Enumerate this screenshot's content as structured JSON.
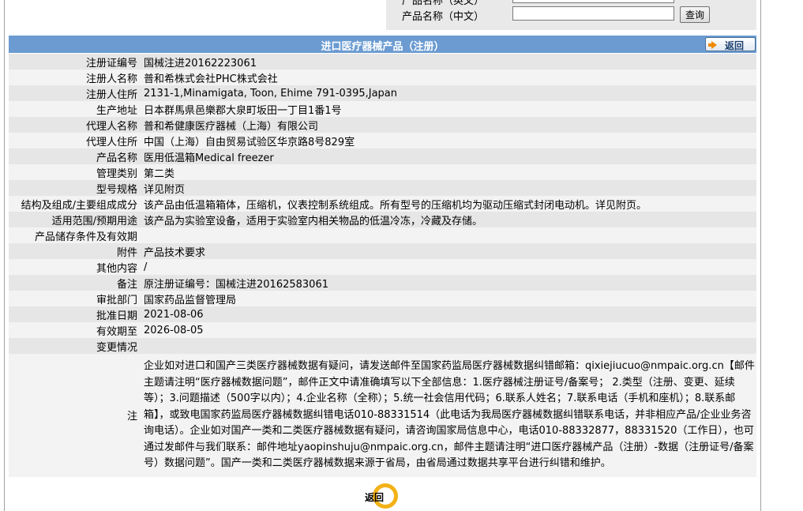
{
  "search": {
    "row1_label": "产品名称（英文）",
    "product_name_cn_label": "产品名称（中文）",
    "product_name_cn_value": "",
    "search_button": "查询"
  },
  "header": {
    "title": "进口医疗器械产品（注册）",
    "back_label": "返回"
  },
  "rows": [
    {
      "label": "注册证编号",
      "value": "国械注进20162223061"
    },
    {
      "label": "注册人名称",
      "value": "普和希株式会社PHC株式会社"
    },
    {
      "label": "注册人住所",
      "value": "2131-1,Minamigata, Toon, Ehime 791-0395,Japan"
    },
    {
      "label": "生产地址",
      "value": "日本群馬県邑樂郡大泉町坂田一丁目1番1号"
    },
    {
      "label": "代理人名称",
      "value": "普和希健康医疗器械（上海）有限公司"
    },
    {
      "label": "代理人住所",
      "value": "中国（上海）自由贸易试验区华京路8号829室"
    },
    {
      "label": "产品名称",
      "value": "医用低温箱Medical freezer"
    },
    {
      "label": "管理类别",
      "value": "第二类"
    },
    {
      "label": "型号规格",
      "value": "详见附页"
    },
    {
      "label": "结构及组成/主要组成成分",
      "value": "该产品由低温箱箱体，压缩机，仪表控制系统组成。所有型号的压缩机均为驱动压缩式封闭电动机。详见附页。"
    },
    {
      "label": "适用范围/预期用途",
      "value": "该产品为实验室设备，适用于实验室内相关物品的低温冷冻，冷藏及存储。"
    },
    {
      "label": "产品储存条件及有效期",
      "value": ""
    },
    {
      "label": "附件",
      "value": "产品技术要求"
    },
    {
      "label": "其他内容",
      "value": "/"
    },
    {
      "label": "备注",
      "value": "原注册证编号：国械注进20162583061"
    },
    {
      "label": "审批部门",
      "value": "国家药品监督管理局"
    },
    {
      "label": "批准日期",
      "value": "2021-08-06"
    },
    {
      "label": "有效期至",
      "value": "2026-08-05"
    },
    {
      "label": "变更情况",
      "value": ""
    }
  ],
  "notice": {
    "label": "注",
    "text": "企业如对进口和国产三类医疗器械数据有疑问，请发送邮件至国家药监局医疗器械数据纠错邮箱：qixiejiucuo@nmpaic.org.cn【邮件主题请注明“医疗器械数据问题”，邮件正文中请准确填写以下全部信息：1.医疗器械注册证号/备案号； 2.类型（注册、变更、延续等）；3.问题描述（500字以内）；4.企业名称（全称）；5.统一社会信用代码；6.联系人姓名；7.联系电话（手机和座机）；8.联系邮箱】，或致电国家药监局医疗器械数据纠错电话010-88331514（此电话为我局医疗器械数据纠错联系电话，并非相应产品/企业业务咨询电话）。企业如对国产一类和二类医疗器械数据有疑问，请咨询国家局信息中心，电话010-88332877，88331520（工作日），也可通过发邮件与我们联系：邮件地址yaopinshuju@nmpaic.org.cn，邮件主题请注明“进口医疗器械产品（注册）-数据（注册证号/备案号）数据问题”。国产一类和二类医疗器械数据来源于省局，由省局通过数据共享平台进行纠错和维护。"
  },
  "footer": {
    "back_label": "返回"
  },
  "colors": {
    "title_bar": "#6b9bd1",
    "row_light": "#f3f3f3",
    "row_dark": "#e6e6e6",
    "accent_orange": "#f2b116"
  }
}
